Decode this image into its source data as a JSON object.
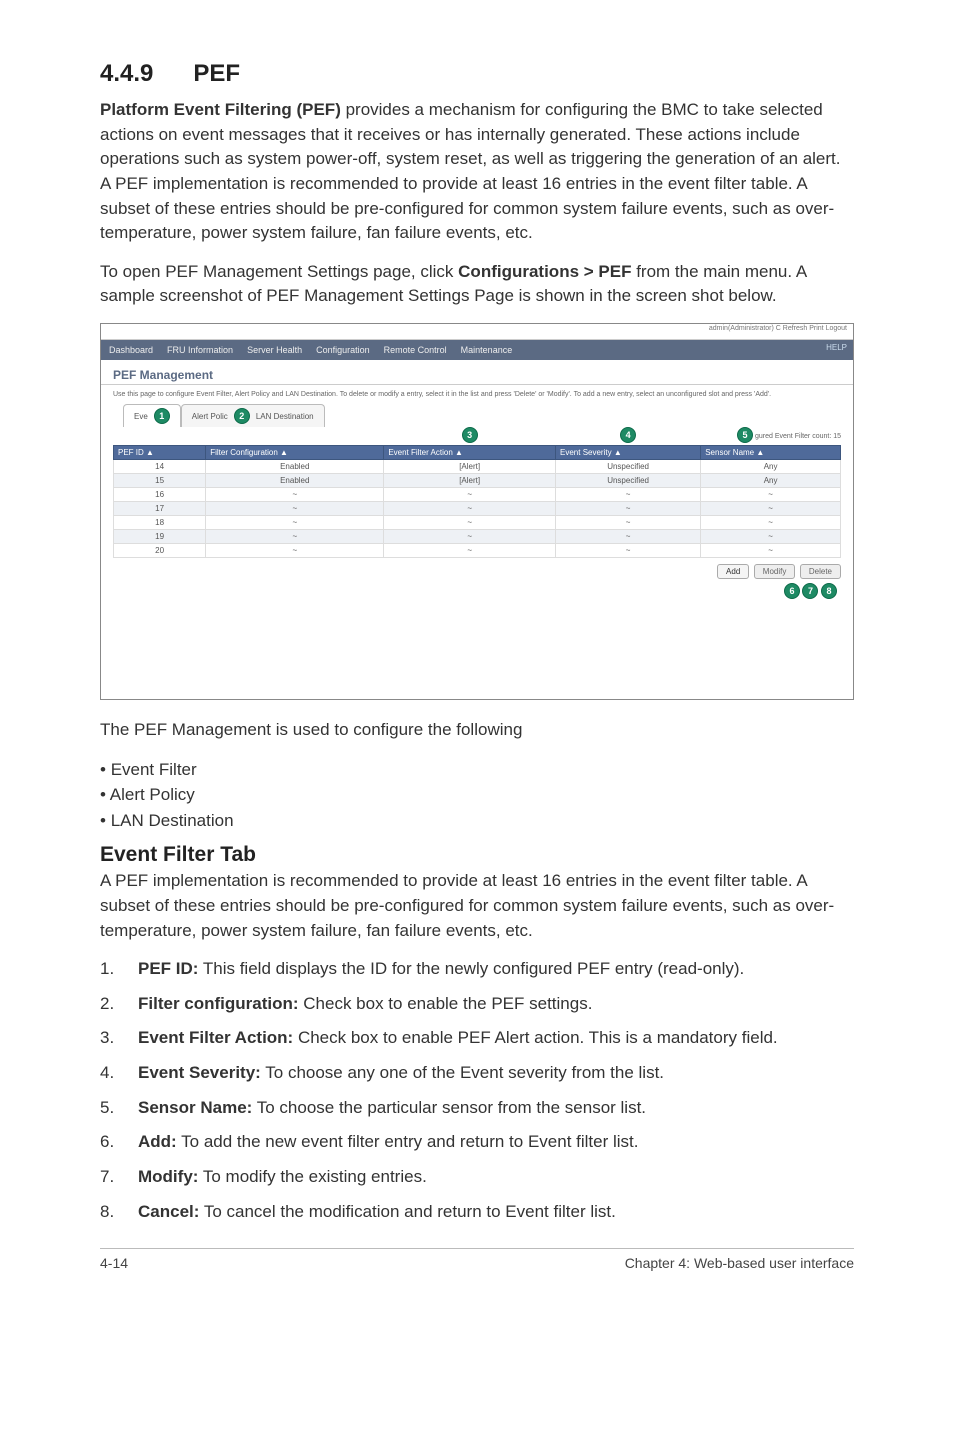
{
  "heading": {
    "number": "4.4.9",
    "title": "PEF"
  },
  "intro1_prefix": "Platform Event Filtering (PEF)",
  "intro1_rest": " provides a mechanism for configuring the BMC to take selected actions on event messages that it receives or has internally generated. These actions include operations such as system power-off, system reset, as well as triggering the generation of an alert. A PEF implementation is recommended to provide at least 16 entries in the event filter table. A subset of these entries should be pre-configured for common system failure events, such as over-temperature, power system failure, fan failure events, etc.",
  "intro2_pre": "To open PEF Management Settings page, click ",
  "intro2_link": "Configurations > PEF",
  "intro2_post": " from the main menu. A sample screenshot of PEF Management Settings Page is shown in the screen shot below.",
  "screenshot": {
    "topright": "admin(Administrator)   C Refresh   Print   Logout",
    "menu": [
      "Dashboard",
      "FRU Information",
      "Server Health",
      "Configuration",
      "Remote Control",
      "Maintenance"
    ],
    "help": "HELP",
    "panel_title": "PEF Management",
    "panel_desc": "Use this page to configure Event Filter, Alert Policy and LAN Destination. To delete or modify a entry, select it in the list and press 'Delete' or 'Modify'. To add a new entry, select an unconfigured slot and press 'Add'.",
    "tabs": {
      "t1_a": "Eve",
      "t2_a": "Alert Polic",
      "t2_b": "LAN Destination"
    },
    "count_label": "gured Event Filter count: 15",
    "headers": [
      "PEF ID  ▲",
      "Filter Configuration  ▲",
      "Event Filter Action  ▲",
      "Event Severity  ▲",
      "Sensor Name  ▲"
    ],
    "rows": [
      {
        "id": "14",
        "cfg": "Enabled",
        "act": "[Alert]",
        "sev": "Unspecified",
        "sen": "Any"
      },
      {
        "id": "15",
        "cfg": "Enabled",
        "act": "[Alert]",
        "sev": "Unspecified",
        "sen": "Any"
      },
      {
        "id": "16",
        "cfg": "~",
        "act": "~",
        "sev": "~",
        "sen": "~"
      },
      {
        "id": "17",
        "cfg": "~",
        "act": "~",
        "sev": "~",
        "sen": "~"
      },
      {
        "id": "18",
        "cfg": "~",
        "act": "~",
        "sev": "~",
        "sen": "~"
      },
      {
        "id": "19",
        "cfg": "~",
        "act": "~",
        "sev": "~",
        "sen": "~"
      },
      {
        "id": "20",
        "cfg": "~",
        "act": "~",
        "sev": "~",
        "sen": "~"
      }
    ],
    "buttons": {
      "add": "Add",
      "modify": "Modify",
      "delete": "Delete"
    }
  },
  "after_ss": "The PEF Management is used to configure the following",
  "bullets": [
    "Event Filter",
    "Alert Policy",
    "LAN Destination"
  ],
  "subheading": "Event Filter Tab",
  "sub_intro": "A PEF implementation is recommended to provide at least 16 entries in the event filter table. A subset of these entries should be pre-configured for common system failure events, such as over-temperature, power system failure, fan failure events, etc.",
  "items": [
    {
      "n": "1.",
      "b": "PEF ID:",
      "t": " This field displays the ID for the newly configured PEF entry (read-only)."
    },
    {
      "n": "2.",
      "b": "Filter configuration:",
      "t": " Check box to enable the PEF settings."
    },
    {
      "n": "3.",
      "b": "Event Filter Action:",
      "t": " Check box to enable PEF Alert action. This is a mandatory field."
    },
    {
      "n": "4.",
      "b": "Event Severity:",
      "t": " To choose any one of the Event severity from the list."
    },
    {
      "n": "5.",
      "b": "Sensor Name:",
      "t": " To choose the particular sensor from the sensor list."
    },
    {
      "n": "6.",
      "b": "Add:",
      "t": " To add the new event filter entry and return to Event filter list."
    },
    {
      "n": "7.",
      "b": "Modify:",
      "t": " To modify the existing entries."
    },
    {
      "n": "8.",
      "b": "Cancel:",
      "t": " To cancel the modification and return to Event filter list."
    }
  ],
  "footer": {
    "left": "4-14",
    "right": "Chapter 4: Web-based user interface"
  }
}
